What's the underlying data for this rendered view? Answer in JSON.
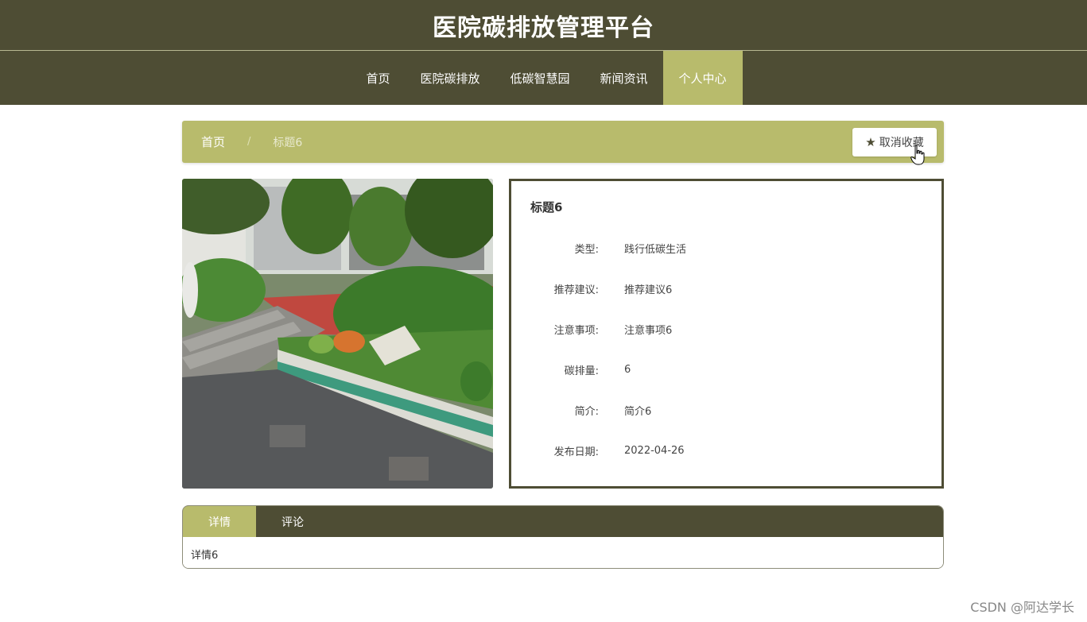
{
  "header": {
    "title": "医院碳排放管理平台"
  },
  "nav": {
    "items": [
      {
        "label": "首页"
      },
      {
        "label": "医院碳排放"
      },
      {
        "label": "低碳智慧园"
      },
      {
        "label": "新闻资讯"
      },
      {
        "label": "个人中心"
      }
    ],
    "active_index": 4
  },
  "breadcrumb": {
    "home": "首页",
    "separator": "/",
    "current": "标题6"
  },
  "favorite_button": {
    "label": "取消收藏",
    "icon": "star-icon"
  },
  "detail": {
    "title": "标题6",
    "fields": [
      {
        "label": "类型:",
        "value": "践行低碳生活"
      },
      {
        "label": "推荐建议:",
        "value": "推荐建议6"
      },
      {
        "label": "注意事项:",
        "value": "注意事项6"
      },
      {
        "label": "碳排量:",
        "value": "6"
      },
      {
        "label": "简介:",
        "value": "简介6"
      },
      {
        "label": "发布日期:",
        "value": "2022-04-26"
      }
    ]
  },
  "tabs": {
    "items": [
      {
        "label": "详情"
      },
      {
        "label": "评论"
      }
    ],
    "active_index": 0,
    "content": "详情6"
  },
  "watermark": "CSDN @阿达学长",
  "colors": {
    "primary": "#4e4d34",
    "accent": "#b8bb6c"
  }
}
